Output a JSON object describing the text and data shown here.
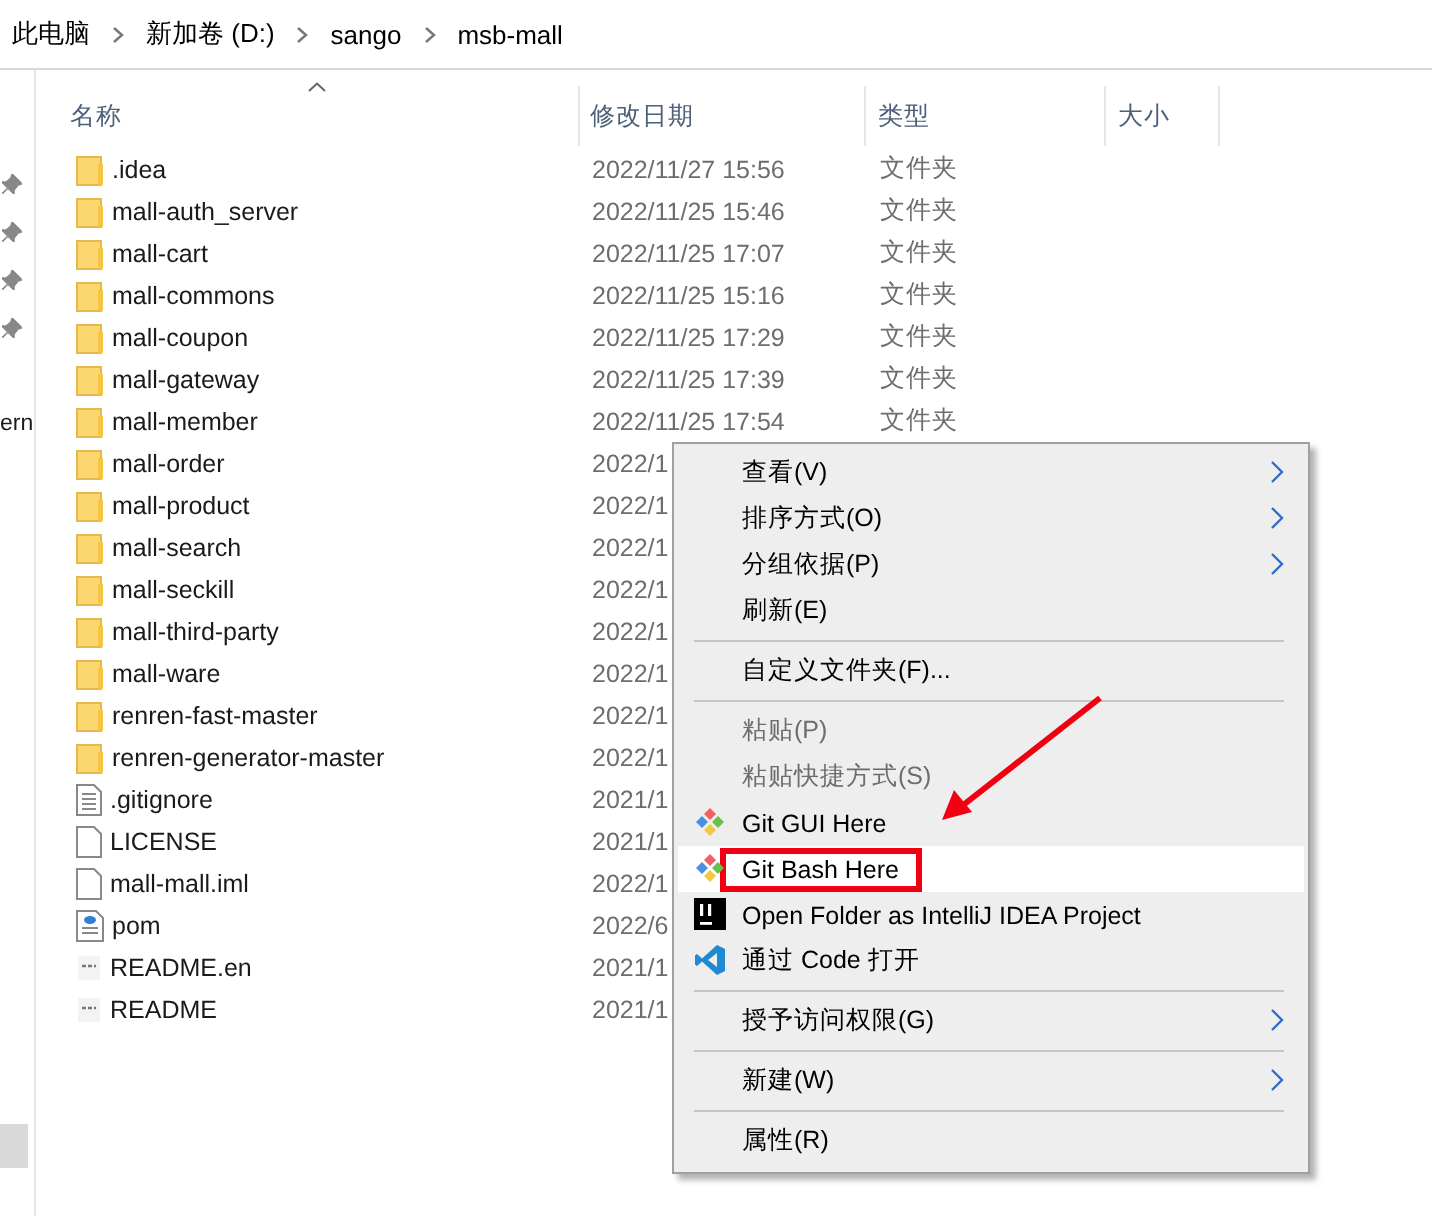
{
  "breadcrumb": [
    "此电脑",
    "新加卷 (D:)",
    "sango",
    "msb-mall"
  ],
  "nav_pane": {
    "partial_label": "ern"
  },
  "columns": [
    {
      "label": "名称",
      "sorted": true
    },
    {
      "label": "修改日期",
      "sorted": false
    },
    {
      "label": "类型",
      "sorted": false
    },
    {
      "label": "大小",
      "sorted": false
    }
  ],
  "rows": [
    {
      "name": ".idea",
      "kind": "folder",
      "date": "2022/11/27 15:56",
      "type": "文件夹"
    },
    {
      "name": "mall-auth_server",
      "kind": "folder",
      "date": "2022/11/25 15:46",
      "type": "文件夹"
    },
    {
      "name": "mall-cart",
      "kind": "folder",
      "date": "2022/11/25 17:07",
      "type": "文件夹"
    },
    {
      "name": "mall-commons",
      "kind": "folder",
      "date": "2022/11/25 15:16",
      "type": "文件夹"
    },
    {
      "name": "mall-coupon",
      "kind": "folder",
      "date": "2022/11/25 17:29",
      "type": "文件夹"
    },
    {
      "name": "mall-gateway",
      "kind": "folder",
      "date": "2022/11/25 17:39",
      "type": "文件夹"
    },
    {
      "name": "mall-member",
      "kind": "folder",
      "date": "2022/11/25 17:54",
      "type": "文件夹"
    },
    {
      "name": "mall-order",
      "kind": "folder",
      "date": "2022/1"
    },
    {
      "name": "mall-product",
      "kind": "folder",
      "date": "2022/1"
    },
    {
      "name": "mall-search",
      "kind": "folder",
      "date": "2022/1"
    },
    {
      "name": "mall-seckill",
      "kind": "folder",
      "date": "2022/1"
    },
    {
      "name": "mall-third-party",
      "kind": "folder",
      "date": "2022/1"
    },
    {
      "name": "mall-ware",
      "kind": "folder",
      "date": "2022/1"
    },
    {
      "name": "renren-fast-master",
      "kind": "folder",
      "date": "2022/1"
    },
    {
      "name": "renren-generator-master",
      "kind": "folder",
      "date": "2022/1"
    },
    {
      "name": ".gitignore",
      "kind": "text",
      "date": "2021/1"
    },
    {
      "name": "LICENSE",
      "kind": "file",
      "date": "2021/1"
    },
    {
      "name": "mall-mall.iml",
      "kind": "file",
      "date": "2022/1"
    },
    {
      "name": "pom",
      "kind": "xml",
      "date": "2022/6"
    },
    {
      "name": "README.en",
      "kind": "readme",
      "date": "2021/1"
    },
    {
      "name": "README",
      "kind": "readme",
      "date": "2021/1"
    }
  ],
  "context_menu": [
    {
      "kind": "item",
      "label": "查看(V)",
      "submenu": true,
      "disabled": false,
      "selected": false
    },
    {
      "kind": "item",
      "label": "排序方式(O)",
      "submenu": true,
      "disabled": false,
      "selected": false
    },
    {
      "kind": "item",
      "label": "分组依据(P)",
      "submenu": true,
      "disabled": false,
      "selected": false
    },
    {
      "kind": "item",
      "label": "刷新(E)",
      "submenu": false,
      "disabled": false,
      "selected": false
    },
    {
      "kind": "separator"
    },
    {
      "kind": "item",
      "label": "自定义文件夹(F)...",
      "submenu": false,
      "disabled": false,
      "selected": false
    },
    {
      "kind": "separator"
    },
    {
      "kind": "item",
      "label": "粘贴(P)",
      "submenu": false,
      "disabled": true,
      "selected": false
    },
    {
      "kind": "item",
      "label": "粘贴快捷方式(S)",
      "submenu": false,
      "disabled": true,
      "selected": false
    },
    {
      "kind": "git",
      "label": "Git GUI Here",
      "submenu": false,
      "disabled": false,
      "selected": false
    },
    {
      "kind": "git",
      "label": "Git Bash Here",
      "submenu": false,
      "disabled": false,
      "selected": true,
      "boxed": true
    },
    {
      "kind": "intellij",
      "label": "Open Folder as IntelliJ IDEA Project",
      "submenu": false,
      "disabled": false,
      "selected": false
    },
    {
      "kind": "vscode",
      "label": "通过 Code 打开",
      "submenu": false,
      "disabled": false,
      "selected": false
    },
    {
      "kind": "separator"
    },
    {
      "kind": "item",
      "label": "授予访问权限(G)",
      "submenu": true,
      "disabled": false,
      "selected": false
    },
    {
      "kind": "separator"
    },
    {
      "kind": "item",
      "label": "新建(W)",
      "submenu": true,
      "disabled": false,
      "selected": false
    },
    {
      "kind": "separator"
    },
    {
      "kind": "item",
      "label": "属性(R)",
      "submenu": false,
      "disabled": false,
      "selected": false
    }
  ]
}
